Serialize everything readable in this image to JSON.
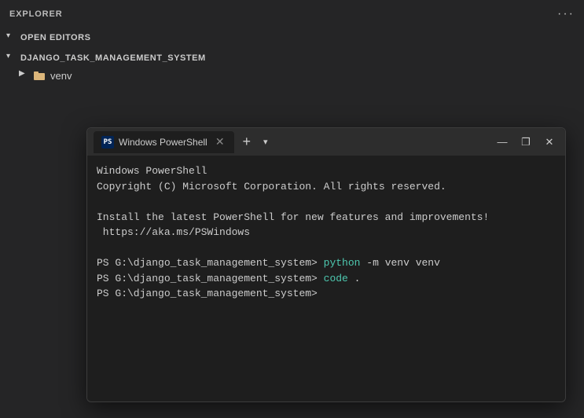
{
  "sidebar": {
    "title": "EXPLORER",
    "dots": "···",
    "sections": [
      {
        "id": "open-editors",
        "label": "OPEN EDITORS",
        "expanded": true,
        "items": []
      },
      {
        "id": "project",
        "label": "DJANGO_TASK_MANAGEMENT_SYSTEM",
        "expanded": true,
        "items": [
          {
            "name": "venv",
            "type": "folder"
          }
        ]
      }
    ]
  },
  "terminal": {
    "title": "Windows PowerShell",
    "tab_label": "Windows PowerShell",
    "body_lines": [
      {
        "id": "line1",
        "text": "Windows PowerShell",
        "type": "normal"
      },
      {
        "id": "line2",
        "text": "Copyright (C) Microsoft Corporation. All rights reserved.",
        "type": "normal"
      },
      {
        "id": "line3",
        "text": "",
        "type": "empty"
      },
      {
        "id": "line4",
        "text": "Install the latest PowerShell for new features and improvements!",
        "type": "normal"
      },
      {
        "id": "line5",
        "text": " https://aka.ms/PSWindows",
        "type": "normal"
      },
      {
        "id": "line6",
        "text": "",
        "type": "empty"
      },
      {
        "id": "line7",
        "text": "PS G:\\django_task_management_system> ",
        "type": "prompt",
        "command_python": "python",
        "command_flag": " -m ",
        "command_args": "venv venv"
      },
      {
        "id": "line8",
        "text": "PS G:\\django_task_management_system> ",
        "type": "prompt2",
        "command_code": "code",
        "command_dot": " ."
      },
      {
        "id": "line9",
        "text": "PS G:\\django_task_management_system>",
        "type": "prompt3"
      }
    ],
    "controls": {
      "minimize": "—",
      "maximize": "❐",
      "close": "✕"
    }
  }
}
